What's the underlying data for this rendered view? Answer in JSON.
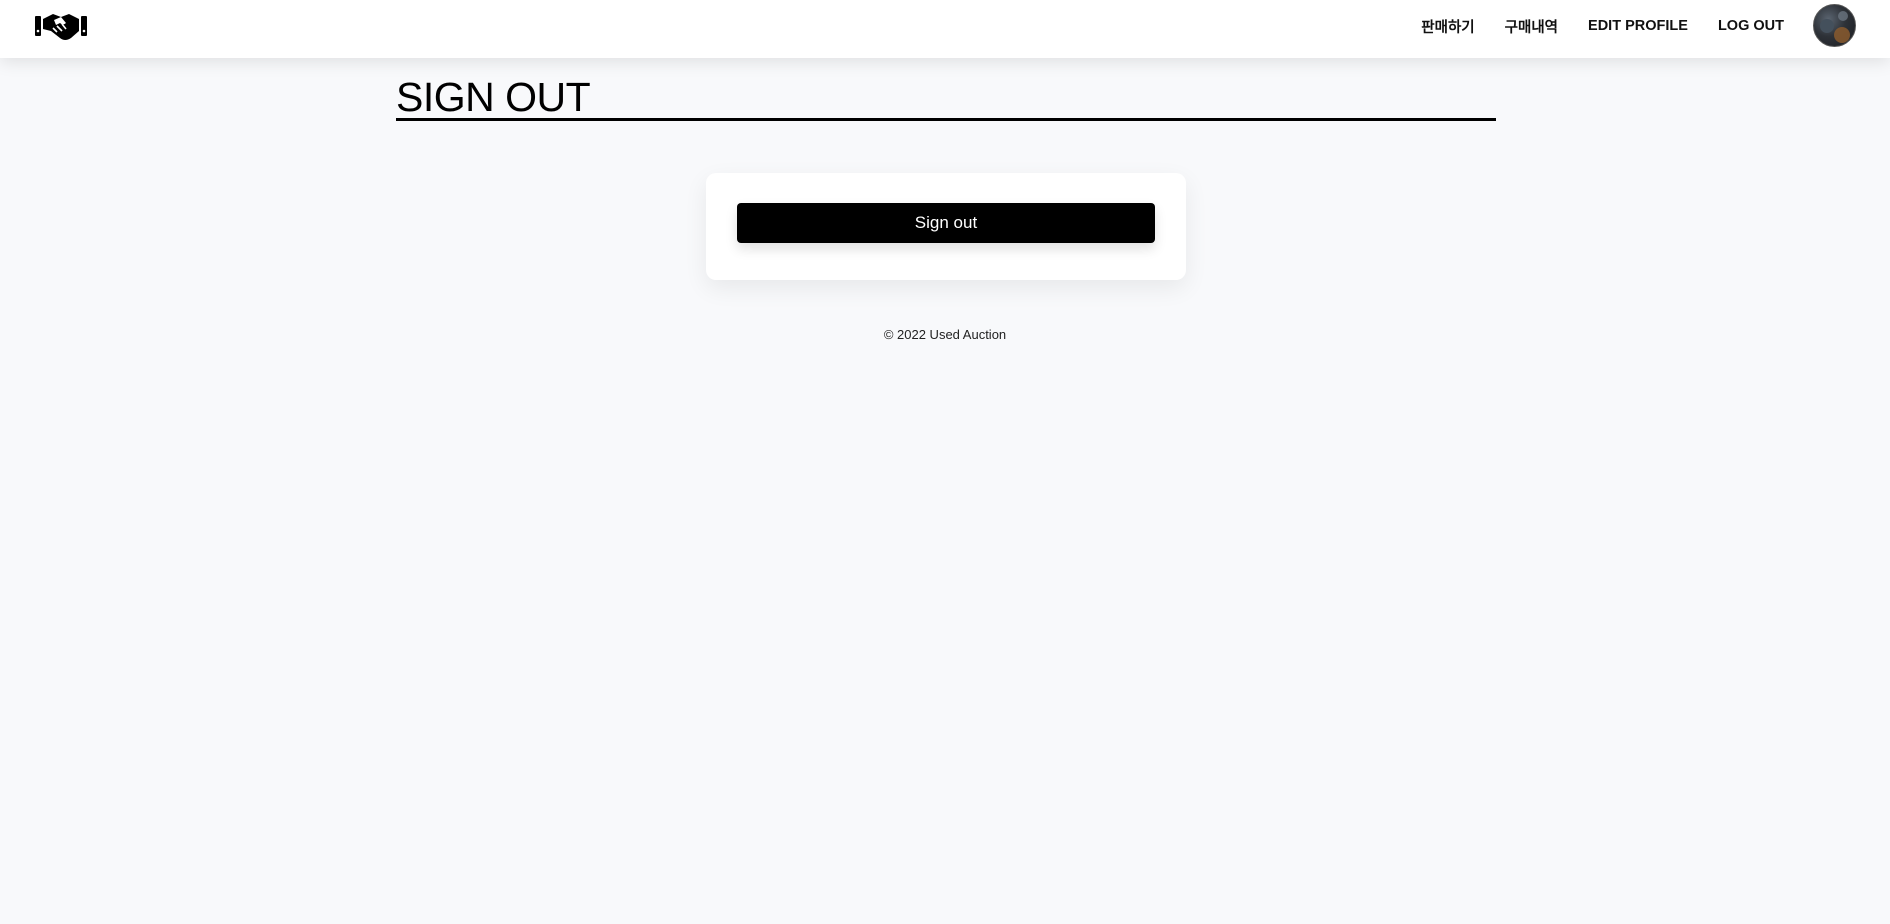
{
  "navbar": {
    "logo_icon": "handshake-icon",
    "links": [
      {
        "label": "판매하기"
      },
      {
        "label": "구매내역"
      },
      {
        "label": "EDIT PROFILE"
      },
      {
        "label": "LOG OUT"
      }
    ],
    "avatar_icon": "user-avatar"
  },
  "main": {
    "title": "SIGN OUT",
    "signout_button_label": "Sign out"
  },
  "footer": {
    "text": "© 2022 Used Auction"
  },
  "colors": {
    "page_background": "#f8f9fb",
    "navbar_background": "#ffffff",
    "button_background": "#000000",
    "button_text": "#ffffff"
  }
}
